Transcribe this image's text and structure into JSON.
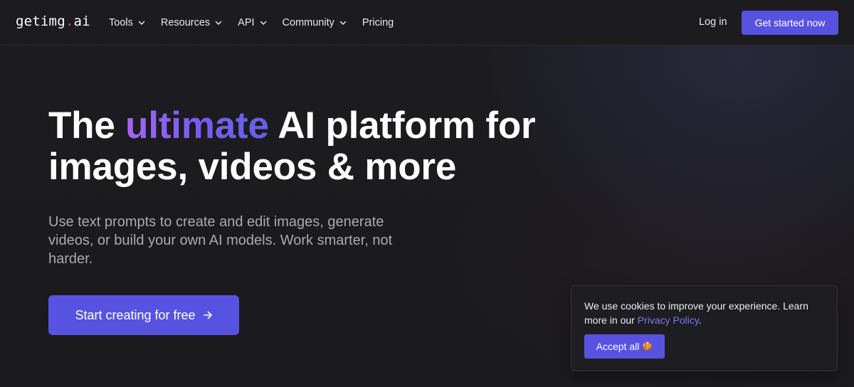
{
  "brand": {
    "logo_main": "getimg",
    "logo_dot": ".",
    "logo_tld": "ai"
  },
  "nav": {
    "items": [
      {
        "label": "Tools",
        "has_dropdown": true
      },
      {
        "label": "Resources",
        "has_dropdown": true
      },
      {
        "label": "API",
        "has_dropdown": true
      },
      {
        "label": "Community",
        "has_dropdown": true
      },
      {
        "label": "Pricing",
        "has_dropdown": false
      }
    ],
    "login_label": "Log in",
    "cta_label": "Get started now"
  },
  "hero": {
    "title_part1": "The ",
    "title_accent": "ultimate",
    "title_part2": " AI platform for",
    "title_line2": "images, videos & more",
    "subtitle": "Use text prompts to create and edit images, generate videos, or build your own AI models. Work smarter, not harder.",
    "cta_label": "Start creating for free"
  },
  "cookie": {
    "text_before": "We use cookies to improve your experience. Learn more in our ",
    "link_text": "Privacy Policy",
    "text_after": ".",
    "accept_label": "Accept all",
    "accept_emoji": "🍪"
  },
  "colors": {
    "accent": "#5753e0",
    "logo_dot": "#e5484d",
    "gradient_start": "#a366f2",
    "gradient_end": "#5f63ea",
    "link": "#7a78f2"
  },
  "icons": {
    "dropdown": "chevron-down-icon",
    "cta_arrow": "arrow-right-icon"
  }
}
